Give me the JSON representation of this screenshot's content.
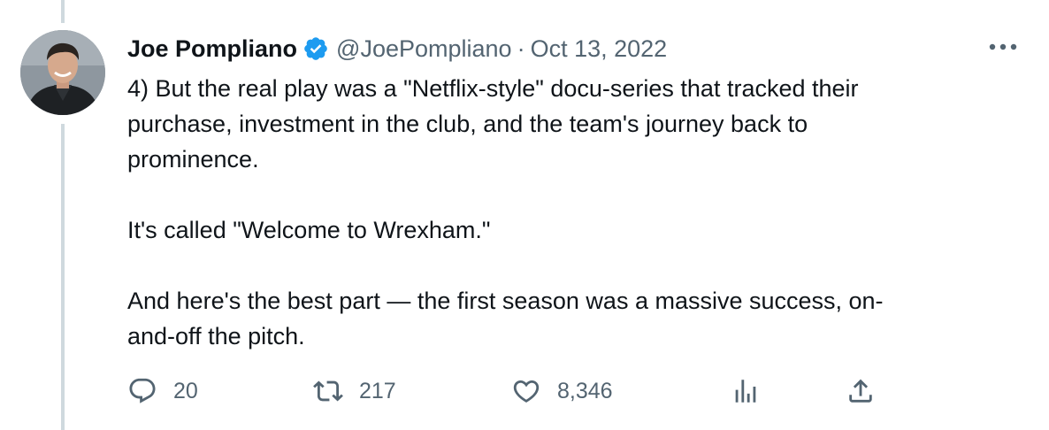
{
  "tweet": {
    "author_name": "Joe Pompliano",
    "handle": "@JoePompliano",
    "separator": "·",
    "date": "Oct 13, 2022",
    "verified_icon": "verified-badge-icon",
    "more_icon": "more-options-icon",
    "paragraphs": [
      "4) But the real play was a \"Netflix-style\" docu-series that tracked their\npurchase, investment in the club, and the team's journey back to\nprominence.",
      "It's called \"Welcome to Wrexham.\"",
      "And here's the best part — the first season was a massive success, on-\nand-off the pitch."
    ]
  },
  "actions": {
    "reply": {
      "icon": "reply-icon",
      "count": "20"
    },
    "retweet": {
      "icon": "retweet-icon",
      "count": "217"
    },
    "like": {
      "icon": "heart-icon",
      "count": "8,346"
    },
    "views": {
      "icon": "views-icon"
    },
    "share": {
      "icon": "share-icon"
    }
  },
  "colors": {
    "text": "#0f1419",
    "secondary": "#536471",
    "verified": "#1d9bf0",
    "thread_line": "#cfd9de"
  }
}
